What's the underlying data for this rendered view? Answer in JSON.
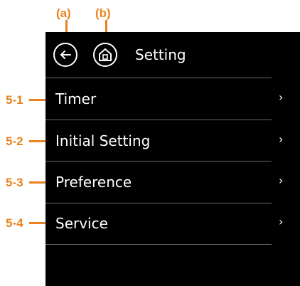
{
  "callouts": {
    "back": "(a)",
    "home": "(b)",
    "timer": "5-1",
    "initial_setting": "5-2",
    "preference": "5-3",
    "service": "5-4"
  },
  "header": {
    "back_icon": "arrow-left-icon",
    "home_icon": "home-icon",
    "title": "Setting"
  },
  "menu": {
    "items": [
      {
        "label": "Timer",
        "chevron": "›"
      },
      {
        "label": "Initial Setting",
        "chevron": "›"
      },
      {
        "label": "Preference",
        "chevron": "›"
      },
      {
        "label": "Service",
        "chevron": "›"
      }
    ]
  },
  "colors": {
    "screen_background": "#000000",
    "text": "#ffffff",
    "divider": "#6a6a6a",
    "annotation": "#e8831f"
  }
}
